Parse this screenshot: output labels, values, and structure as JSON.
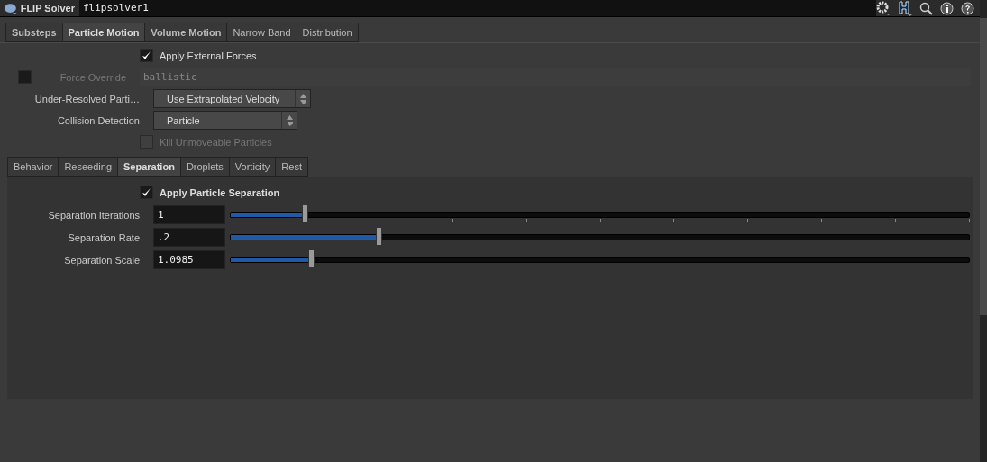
{
  "header": {
    "node_type": "FLIP Solver",
    "node_name": "flipsolver1"
  },
  "tabs": [
    {
      "label": "Substeps",
      "selected": false,
      "bold": true
    },
    {
      "label": "Particle Motion",
      "selected": true,
      "bold": true
    },
    {
      "label": "Volume Motion",
      "selected": false,
      "bold": true
    },
    {
      "label": "Narrow Band",
      "selected": false,
      "bold": false
    },
    {
      "label": "Distribution",
      "selected": false,
      "bold": false
    }
  ],
  "params": [
    {
      "kind": "checkbox",
      "label": "Apply External Forces",
      "checked": true,
      "disabled": false
    },
    {
      "kind": "override",
      "label": "Force Override",
      "checked": false,
      "value": "ballistic",
      "disabled": true
    },
    {
      "kind": "menu",
      "label": "Under-Resolved Parti…",
      "value": "Use Extrapolated Velocity",
      "wide": true
    },
    {
      "kind": "menu",
      "label": "Collision Detection",
      "value": "Particle",
      "wide": false
    },
    {
      "kind": "checkbox",
      "label": "Kill Unmoveable Particles",
      "checked": false,
      "disabled": true
    }
  ],
  "subtabs": [
    {
      "label": "Behavior",
      "selected": false
    },
    {
      "label": "Reseeding",
      "selected": false
    },
    {
      "label": "Separation",
      "selected": true
    },
    {
      "label": "Droplets",
      "selected": false
    },
    {
      "label": "Vorticity",
      "selected": false
    },
    {
      "label": "Rest",
      "selected": false
    }
  ],
  "separation": {
    "toggle": {
      "label": "Apply Particle Separation",
      "checked": true
    },
    "sliders": [
      {
        "label": "Separation Iterations",
        "value": "1",
        "level": 0.1,
        "ticks": true
      },
      {
        "label": "Separation Rate",
        "value": ".2",
        "level": 0.2,
        "ticks": false
      },
      {
        "label": "Separation Scale",
        "value": "1.0985",
        "level": 0.109,
        "ticks": false
      }
    ]
  }
}
